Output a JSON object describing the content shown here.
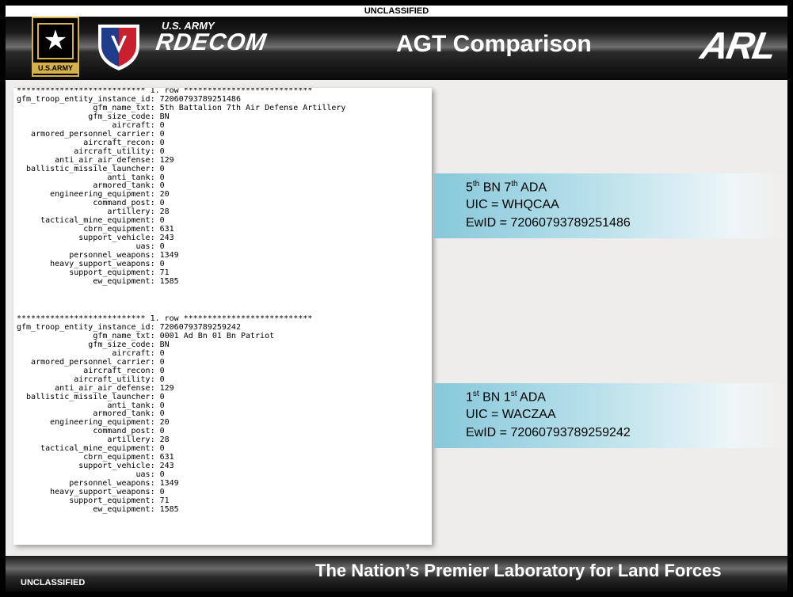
{
  "classification_top": "UNCLASSIFIED",
  "classification_bottom": "UNCLASSIFIED",
  "header": {
    "army_logo_text": "U.S.ARMY",
    "rdecom_small": "U.S. ARMY",
    "rdecom_big": "RDECOM",
    "title": "AGT Comparison",
    "arl_logo": "ARL"
  },
  "record1": {
    "row_marker": "*************************** 1. row ***************************",
    "fields": [
      {
        "name": "gfm_troop_entity_instance_id",
        "value": "72060793789251486"
      },
      {
        "name": "gfm_name_txt",
        "value": "5th Battalion 7th Air Defense Artillery"
      },
      {
        "name": "gfm_size_code",
        "value": "BN"
      },
      {
        "name": "aircraft",
        "value": "0"
      },
      {
        "name": "armored_personnel_carrier",
        "value": "0"
      },
      {
        "name": "aircraft_recon",
        "value": "0"
      },
      {
        "name": "aircraft_utility",
        "value": "0"
      },
      {
        "name": "anti_air_air_defense",
        "value": "129"
      },
      {
        "name": "ballistic_missile_launcher",
        "value": "0"
      },
      {
        "name": "anti_tank",
        "value": "0"
      },
      {
        "name": "armored_tank",
        "value": "0"
      },
      {
        "name": "engineering_equipment",
        "value": "20"
      },
      {
        "name": "command_post",
        "value": "0"
      },
      {
        "name": "artillery",
        "value": "28"
      },
      {
        "name": "tactical_mine_equipment",
        "value": "0"
      },
      {
        "name": "cbrn_equipment",
        "value": "631"
      },
      {
        "name": "support_vehicle",
        "value": "243"
      },
      {
        "name": "uas",
        "value": "0"
      },
      {
        "name": "personnel_weapons",
        "value": "1349"
      },
      {
        "name": "heavy_support_weapons",
        "value": "0"
      },
      {
        "name": "support_equipment",
        "value": "71"
      },
      {
        "name": "ew_equipment",
        "value": "1585"
      }
    ]
  },
  "record2": {
    "row_marker": "*************************** 1. row ***************************",
    "fields": [
      {
        "name": "gfm_troop_entity_instance_id",
        "value": "72060793789259242"
      },
      {
        "name": "gfm_name_txt",
        "value": "0001 Ad Bn 01 Bn Patriot"
      },
      {
        "name": "gfm_size_code",
        "value": "BN"
      },
      {
        "name": "aircraft",
        "value": "0"
      },
      {
        "name": "armored_personnel_carrier",
        "value": "0"
      },
      {
        "name": "aircraft_recon",
        "value": "0"
      },
      {
        "name": "aircraft_utility",
        "value": "0"
      },
      {
        "name": "anti_air_air_defense",
        "value": "129"
      },
      {
        "name": "ballistic_missile_launcher",
        "value": "0"
      },
      {
        "name": "anti_tank",
        "value": "0"
      },
      {
        "name": "armored_tank",
        "value": "0"
      },
      {
        "name": "engineering_equipment",
        "value": "20"
      },
      {
        "name": "command_post",
        "value": "0"
      },
      {
        "name": "artillery",
        "value": "28"
      },
      {
        "name": "tactical_mine_equipment",
        "value": "0"
      },
      {
        "name": "cbrn_equipment",
        "value": "631"
      },
      {
        "name": "support_vehicle",
        "value": "243"
      },
      {
        "name": "uas",
        "value": "0"
      },
      {
        "name": "personnel_weapons",
        "value": "1349"
      },
      {
        "name": "heavy_support_weapons",
        "value": "0"
      },
      {
        "name": "support_equipment",
        "value": "71"
      },
      {
        "name": "ew_equipment",
        "value": "1585"
      }
    ]
  },
  "callout1": {
    "unit_a": "5",
    "unit_a_sup": "th",
    "unit_mid": " BN 7",
    "unit_b_sup": "th",
    "unit_end": " ADA",
    "uic": "UIC = WHQCAA",
    "ewid": "EwID = 72060793789251486"
  },
  "callout2": {
    "unit_a": "1",
    "unit_a_sup": "st",
    "unit_mid": " BN 1",
    "unit_b_sup": "st",
    "unit_end": " ADA",
    "uic": "UIC = WACZAA",
    "ewid": "EwID = 72060793789259242"
  },
  "footer": {
    "tagline": "The Nation’s Premier Laboratory for Land Forces"
  },
  "colors": {
    "gold": "#d4b14a",
    "callout_blue": "#87c8da",
    "background": "#efedeb"
  }
}
